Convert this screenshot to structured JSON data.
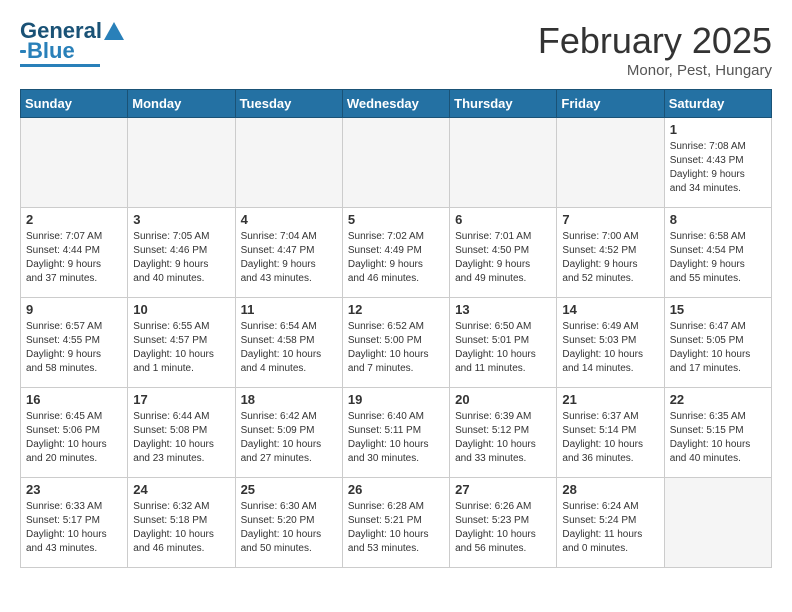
{
  "header": {
    "logo": {
      "part1": "General",
      "part2": "Blue"
    },
    "title": "February 2025",
    "subtitle": "Monor, Pest, Hungary"
  },
  "weekdays": [
    "Sunday",
    "Monday",
    "Tuesday",
    "Wednesday",
    "Thursday",
    "Friday",
    "Saturday"
  ],
  "weeks": [
    [
      {
        "day": null,
        "info": ""
      },
      {
        "day": null,
        "info": ""
      },
      {
        "day": null,
        "info": ""
      },
      {
        "day": null,
        "info": ""
      },
      {
        "day": null,
        "info": ""
      },
      {
        "day": null,
        "info": ""
      },
      {
        "day": "1",
        "info": "Sunrise: 7:08 AM\nSunset: 4:43 PM\nDaylight: 9 hours\nand 34 minutes."
      }
    ],
    [
      {
        "day": "2",
        "info": "Sunrise: 7:07 AM\nSunset: 4:44 PM\nDaylight: 9 hours\nand 37 minutes."
      },
      {
        "day": "3",
        "info": "Sunrise: 7:05 AM\nSunset: 4:46 PM\nDaylight: 9 hours\nand 40 minutes."
      },
      {
        "day": "4",
        "info": "Sunrise: 7:04 AM\nSunset: 4:47 PM\nDaylight: 9 hours\nand 43 minutes."
      },
      {
        "day": "5",
        "info": "Sunrise: 7:02 AM\nSunset: 4:49 PM\nDaylight: 9 hours\nand 46 minutes."
      },
      {
        "day": "6",
        "info": "Sunrise: 7:01 AM\nSunset: 4:50 PM\nDaylight: 9 hours\nand 49 minutes."
      },
      {
        "day": "7",
        "info": "Sunrise: 7:00 AM\nSunset: 4:52 PM\nDaylight: 9 hours\nand 52 minutes."
      },
      {
        "day": "8",
        "info": "Sunrise: 6:58 AM\nSunset: 4:54 PM\nDaylight: 9 hours\nand 55 minutes."
      }
    ],
    [
      {
        "day": "9",
        "info": "Sunrise: 6:57 AM\nSunset: 4:55 PM\nDaylight: 9 hours\nand 58 minutes."
      },
      {
        "day": "10",
        "info": "Sunrise: 6:55 AM\nSunset: 4:57 PM\nDaylight: 10 hours\nand 1 minute."
      },
      {
        "day": "11",
        "info": "Sunrise: 6:54 AM\nSunset: 4:58 PM\nDaylight: 10 hours\nand 4 minutes."
      },
      {
        "day": "12",
        "info": "Sunrise: 6:52 AM\nSunset: 5:00 PM\nDaylight: 10 hours\nand 7 minutes."
      },
      {
        "day": "13",
        "info": "Sunrise: 6:50 AM\nSunset: 5:01 PM\nDaylight: 10 hours\nand 11 minutes."
      },
      {
        "day": "14",
        "info": "Sunrise: 6:49 AM\nSunset: 5:03 PM\nDaylight: 10 hours\nand 14 minutes."
      },
      {
        "day": "15",
        "info": "Sunrise: 6:47 AM\nSunset: 5:05 PM\nDaylight: 10 hours\nand 17 minutes."
      }
    ],
    [
      {
        "day": "16",
        "info": "Sunrise: 6:45 AM\nSunset: 5:06 PM\nDaylight: 10 hours\nand 20 minutes."
      },
      {
        "day": "17",
        "info": "Sunrise: 6:44 AM\nSunset: 5:08 PM\nDaylight: 10 hours\nand 23 minutes."
      },
      {
        "day": "18",
        "info": "Sunrise: 6:42 AM\nSunset: 5:09 PM\nDaylight: 10 hours\nand 27 minutes."
      },
      {
        "day": "19",
        "info": "Sunrise: 6:40 AM\nSunset: 5:11 PM\nDaylight: 10 hours\nand 30 minutes."
      },
      {
        "day": "20",
        "info": "Sunrise: 6:39 AM\nSunset: 5:12 PM\nDaylight: 10 hours\nand 33 minutes."
      },
      {
        "day": "21",
        "info": "Sunrise: 6:37 AM\nSunset: 5:14 PM\nDaylight: 10 hours\nand 36 minutes."
      },
      {
        "day": "22",
        "info": "Sunrise: 6:35 AM\nSunset: 5:15 PM\nDaylight: 10 hours\nand 40 minutes."
      }
    ],
    [
      {
        "day": "23",
        "info": "Sunrise: 6:33 AM\nSunset: 5:17 PM\nDaylight: 10 hours\nand 43 minutes."
      },
      {
        "day": "24",
        "info": "Sunrise: 6:32 AM\nSunset: 5:18 PM\nDaylight: 10 hours\nand 46 minutes."
      },
      {
        "day": "25",
        "info": "Sunrise: 6:30 AM\nSunset: 5:20 PM\nDaylight: 10 hours\nand 50 minutes."
      },
      {
        "day": "26",
        "info": "Sunrise: 6:28 AM\nSunset: 5:21 PM\nDaylight: 10 hours\nand 53 minutes."
      },
      {
        "day": "27",
        "info": "Sunrise: 6:26 AM\nSunset: 5:23 PM\nDaylight: 10 hours\nand 56 minutes."
      },
      {
        "day": "28",
        "info": "Sunrise: 6:24 AM\nSunset: 5:24 PM\nDaylight: 11 hours\nand 0 minutes."
      },
      {
        "day": null,
        "info": ""
      }
    ]
  ]
}
